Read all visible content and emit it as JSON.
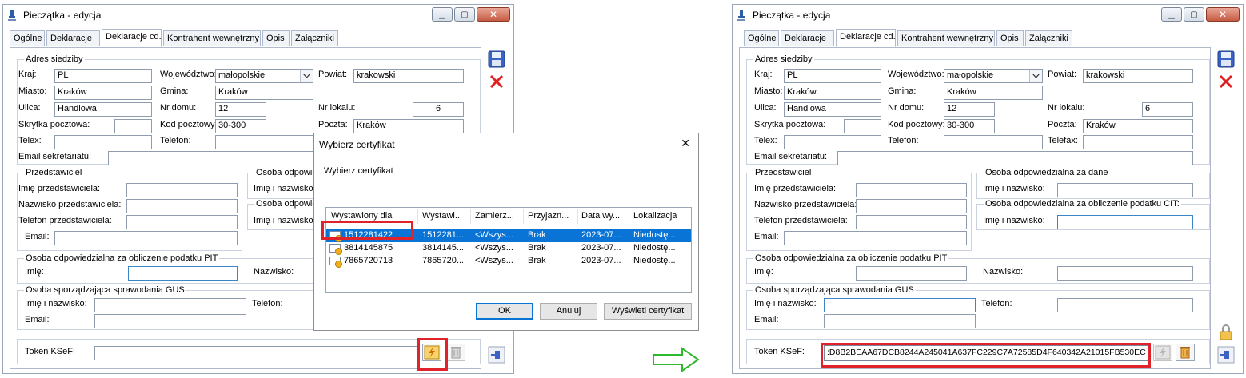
{
  "window": {
    "title": "Pieczątka - edycja",
    "controls": {
      "minimize": "▁",
      "maximize": "▢",
      "close": "✕"
    }
  },
  "tabs": [
    "Ogólne",
    "Deklaracje",
    "Deklaracje cd.",
    "Kontrahent wewnętrzny",
    "Opis",
    "Załączniki"
  ],
  "address": {
    "title": "Adres siedziby",
    "kraj_label": "Kraj:",
    "kraj": "PL",
    "woj_label": "Województwo:",
    "woj": "małopolskie",
    "powiat_label": "Powiat:",
    "powiat": "krakowski",
    "miasto_label": "Miasto:",
    "miasto": "Kraków",
    "gmina_label": "Gmina:",
    "gmina": "Kraków",
    "ulica_label": "Ulica:",
    "ulica": "Handlowa",
    "nrdomu_label": "Nr domu:",
    "nrdomu": "12",
    "nrlokalu_label": "Nr lokalu:",
    "nrlokalu": "6",
    "skrytka_label": "Skrytka pocztowa:",
    "kod_label": "Kod pocztowy:",
    "kod": "30-300",
    "poczta_label": "Poczta:",
    "poczta": "Kraków",
    "telex_label": "Telex:",
    "telefon_label": "Telefon:",
    "telefax_label": "Telefax:",
    "email_sekr_label": "Email sekretariatu:"
  },
  "przedstawiciel": {
    "title": "Przedstawiciel",
    "imie_label": "Imię przedstawiciela:",
    "nazwisko_label": "Nazwisko przedstawiciela:",
    "telefon_label": "Telefon przedstawiciela:",
    "email_label": "Email:"
  },
  "osoba_dane": {
    "title": "Osoba odpowiedzialna za dane",
    "title_clipped": "Osoba odpowie",
    "imie_label": "Imię i nazwisko:"
  },
  "osoba_cit": {
    "title": "Osoba odpowiedzialna za obliczenie podatku CIT:",
    "title_clipped": "Osoba odpowie",
    "imie_label": "Imię i nazwisko:"
  },
  "osoba_pit": {
    "title": "Osoba odpowiedzialna za obliczenie podatku PIT",
    "imie_label": "Imię:",
    "nazwisko_label": "Nazwisko:"
  },
  "gus": {
    "title": "Osoba sporządzająca sprawodania GUS",
    "imie_label": "Imię i nazwisko:",
    "telefon_label": "Telefon:",
    "email_label": "Email:"
  },
  "token": {
    "label": "Token KSeF:",
    "value": ":D8B2BEAA67DCB8244A245041A637FC229C7A72585D4F640342A21015FB530EC"
  },
  "dialog": {
    "title": "Wybierz certyfikat",
    "close": "✕",
    "subtitle": "Wybierz certyfikat",
    "columns": [
      "Wystawiony dla",
      "Wystawi...",
      "Zamierz...",
      "Przyjazn...",
      "Data wy...",
      "Lokalizacja"
    ],
    "rows": [
      [
        "1512281422",
        "1512281...",
        "<Wszys...",
        "Brak",
        "2023-07...",
        "Niedostę..."
      ],
      [
        "3814145875",
        "3814145...",
        "<Wszys...",
        "Brak",
        "2023-07...",
        "Niedostę..."
      ],
      [
        "7865720713",
        "7865720...",
        "<Wszys...",
        "Brak",
        "2023-07...",
        "Niedostę..."
      ]
    ],
    "ok": "OK",
    "cancel": "Anuluj",
    "show_cert": "Wyświetl certyfikat"
  },
  "colors": {
    "highlight": "#e0222b",
    "selection": "#0a74d6",
    "arrow": "#2eb82e"
  }
}
